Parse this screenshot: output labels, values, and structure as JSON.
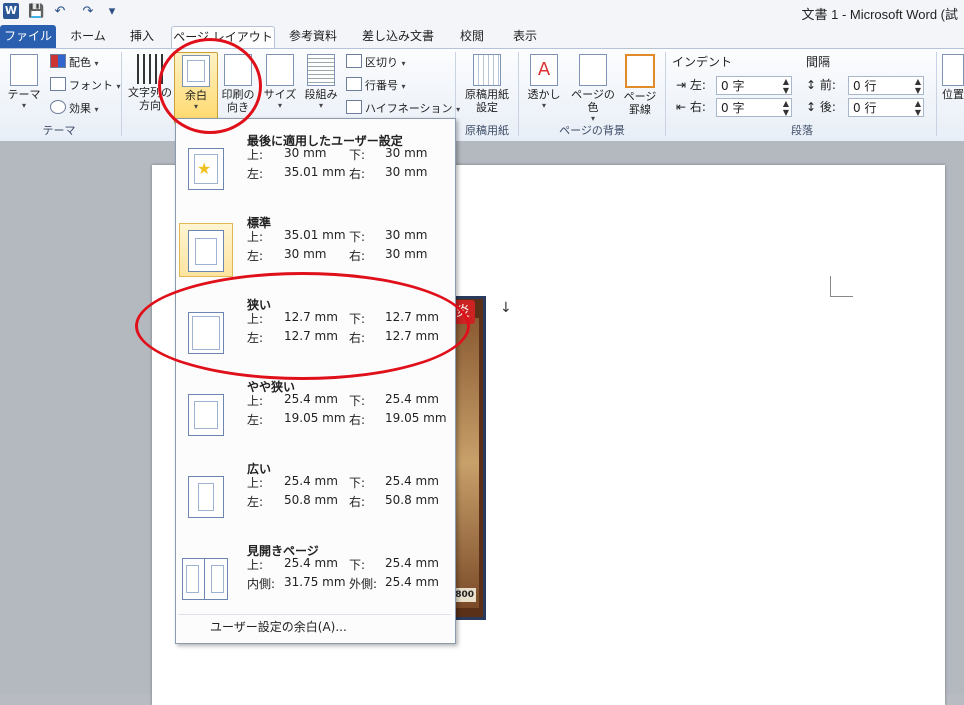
{
  "window": {
    "title": "文書 1 - Microsoft Word (試",
    "logo": "W"
  },
  "qat": {
    "save": "💾",
    "undo": "↶",
    "redo": "↷",
    "customize": "▾"
  },
  "tabs": [
    {
      "label": "ファイル"
    },
    {
      "label": "ホーム"
    },
    {
      "label": "挿入"
    },
    {
      "label": "ページ レイアウト"
    },
    {
      "label": "参考資料"
    },
    {
      "label": "差し込み文書"
    },
    {
      "label": "校閲"
    },
    {
      "label": "表示"
    }
  ],
  "ribbon": {
    "theme": {
      "group_label": "テーマ",
      "theme_btn": "テーマ",
      "colors": "配色",
      "fonts": "フォント",
      "effects": "効果"
    },
    "page_setup": {
      "text_direction": "文字列の方向",
      "margins": "余白",
      "orientation": "印刷の向き",
      "size": "サイズ",
      "columns": "段組み",
      "breaks": "区切り",
      "line_numbers": "行番号",
      "hyphenation": "ハイフネーション"
    },
    "manuscript": {
      "group_label": "原稿用紙",
      "btn": "原稿用紙設定"
    },
    "page_background": {
      "group_label": "ページの背景",
      "watermark": "透かし",
      "page_color": "ページの色",
      "page_borders": "ページ罫線"
    },
    "paragraph": {
      "group_label": "段落",
      "indent_label": "インデント",
      "spacing_label": "間隔",
      "left_label": "左:",
      "left_value": "0 字",
      "right_label": "右:",
      "right_value": "0 字",
      "before_label": "前:",
      "before_value": "0 行",
      "after_label": "後:",
      "after_value": "0 行"
    },
    "arrange": {
      "position": "位置"
    }
  },
  "margins_menu": {
    "items": [
      {
        "title": "最後に適用したユーザー設定",
        "top_label": "上:",
        "top": "30 mm",
        "bottom_label": "下:",
        "bottom": "30 mm",
        "left_label": "左:",
        "left": "35.01 mm",
        "right_label": "右:",
        "right": "30 mm",
        "icon": "star-icon"
      },
      {
        "title": "標準",
        "top_label": "上:",
        "top": "35.01 mm",
        "bottom_label": "下:",
        "bottom": "30 mm",
        "left_label": "左:",
        "left": "30 mm",
        "right_label": "右:",
        "right": "30 mm",
        "selected": true
      },
      {
        "title": "狭い",
        "top_label": "上:",
        "top": "12.7 mm",
        "bottom_label": "下:",
        "bottom": "12.7 mm",
        "left_label": "左:",
        "left": "12.7 mm",
        "right_label": "右:",
        "right": "12.7 mm"
      },
      {
        "title": "やや狭い",
        "top_label": "上:",
        "top": "25.4 mm",
        "bottom_label": "下:",
        "bottom": "25.4 mm",
        "left_label": "左:",
        "left": "19.05 mm",
        "right_label": "右:",
        "right": "19.05 mm"
      },
      {
        "title": "広い",
        "top_label": "上:",
        "top": "25.4 mm",
        "bottom_label": "下:",
        "bottom": "25.4 mm",
        "left_label": "左:",
        "left": "50.8 mm",
        "right_label": "右:",
        "right": "50.8 mm"
      },
      {
        "title": "見開きページ",
        "top_label": "上:",
        "top": "25.4 mm",
        "bottom_label": "下:",
        "bottom": "25.4 mm",
        "left_label": "内側:",
        "left": "31.75 mm",
        "right_label": "外側:",
        "right": "25.4 mm"
      }
    ],
    "custom": "ユーザー設定の余白(A)..."
  },
  "document": {
    "card_symbol": "炎",
    "card_atk": "800",
    "return_mark": "↓"
  },
  "annotation": {
    "color": "#e0101a"
  }
}
